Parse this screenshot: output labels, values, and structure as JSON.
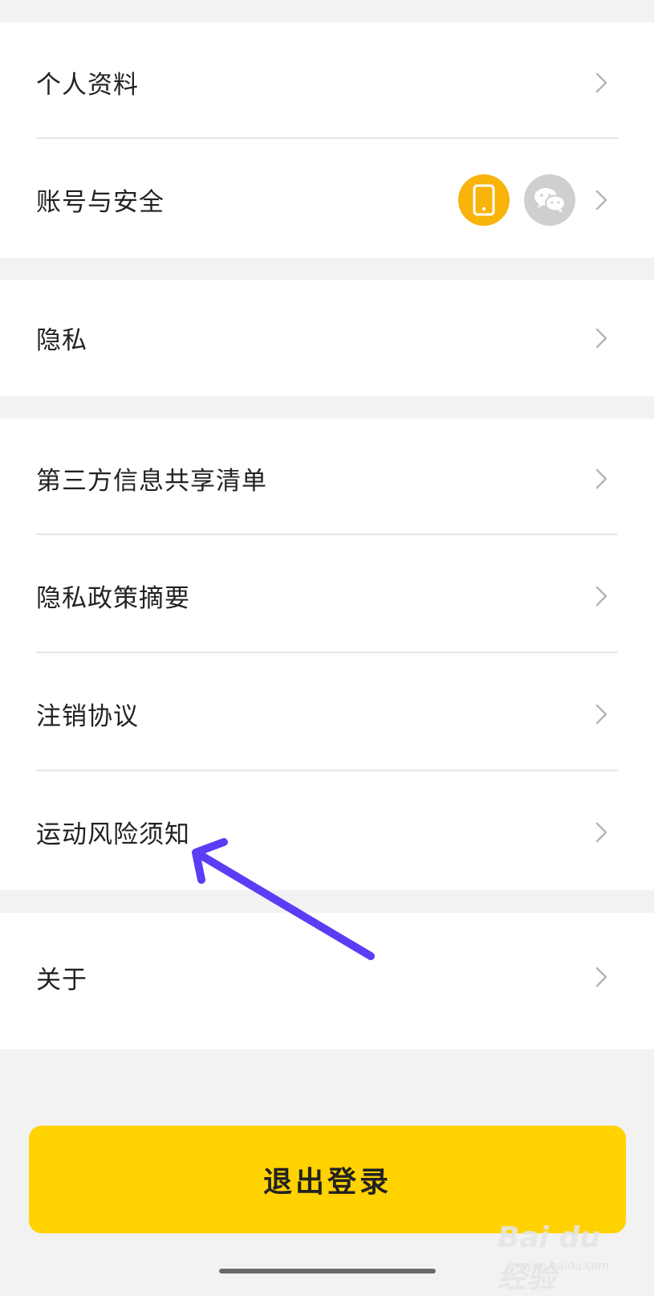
{
  "groups": {
    "profile": {
      "label": "个人资料"
    },
    "account": {
      "label": "账号与安全",
      "badges": [
        "phone-icon",
        "wechat-icon"
      ]
    },
    "privacy": {
      "label": "隐私"
    },
    "third_party": {
      "label": "第三方信息共享清单"
    },
    "policy_summary": {
      "label": "隐私政策摘要"
    },
    "cancel_agreement": {
      "label": "注销协议"
    },
    "sport_risk": {
      "label": "运动风险须知"
    },
    "about": {
      "label": "关于"
    }
  },
  "logout": {
    "label": "退出登录"
  },
  "watermark": {
    "logo": "Bai du 经验",
    "sub": "jingyan.baidu.com"
  },
  "colors": {
    "accent": "#ffd200",
    "phone_badge": "#f8b40a",
    "wechat_badge": "#cfcfcf",
    "arrow": "#5b3df5"
  }
}
